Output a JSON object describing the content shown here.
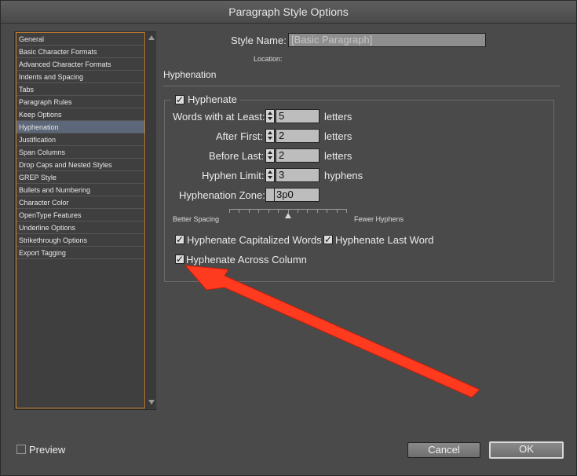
{
  "window": {
    "title": "Paragraph Style Options"
  },
  "categories": [
    "General",
    "Basic Character Formats",
    "Advanced Character Formats",
    "Indents and Spacing",
    "Tabs",
    "Paragraph Rules",
    "Keep Options",
    "Hyphenation",
    "Justification",
    "Span Columns",
    "Drop Caps and Nested Styles",
    "GREP Style",
    "Bullets and Numbering",
    "Character Color",
    "OpenType Features",
    "Underline Options",
    "Strikethrough Options",
    "Export Tagging"
  ],
  "selected_category": "Hyphenation",
  "style_name": {
    "label": "Style Name:",
    "value": "[Basic Paragraph]"
  },
  "location": {
    "label": "Location:"
  },
  "section_title": "Hyphenation",
  "hyphenate": {
    "label": "Hyphenate",
    "checked": true
  },
  "words_at_least": {
    "label": "Words with at Least:",
    "value": "5",
    "unit": "letters"
  },
  "after_first": {
    "label": "After First:",
    "value": "2",
    "unit": "letters"
  },
  "before_last": {
    "label": "Before Last:",
    "value": "2",
    "unit": "letters"
  },
  "hyphen_limit": {
    "label": "Hyphen Limit:",
    "value": "3",
    "unit": "hyphens"
  },
  "hyphenation_zone": {
    "label": "Hyphenation Zone:",
    "value": "3p0"
  },
  "slider": {
    "left_label": "Better Spacing",
    "right_label": "Fewer Hyphens",
    "level": 0.5
  },
  "capitalized": {
    "label": "Hyphenate Capitalized Words",
    "checked": true
  },
  "last_word": {
    "label": "Hyphenate Last Word",
    "checked": true
  },
  "across_column": {
    "label": "Hyphenate Across Column",
    "checked": true
  },
  "preview": {
    "label": "Preview",
    "checked": false
  },
  "buttons": {
    "cancel": "Cancel",
    "ok": "OK"
  },
  "colors": {
    "annotation_arrow": "#ff3b1f",
    "selection": "#5c6779",
    "list_focus": "#c8822e"
  },
  "check_glyph": "✓"
}
